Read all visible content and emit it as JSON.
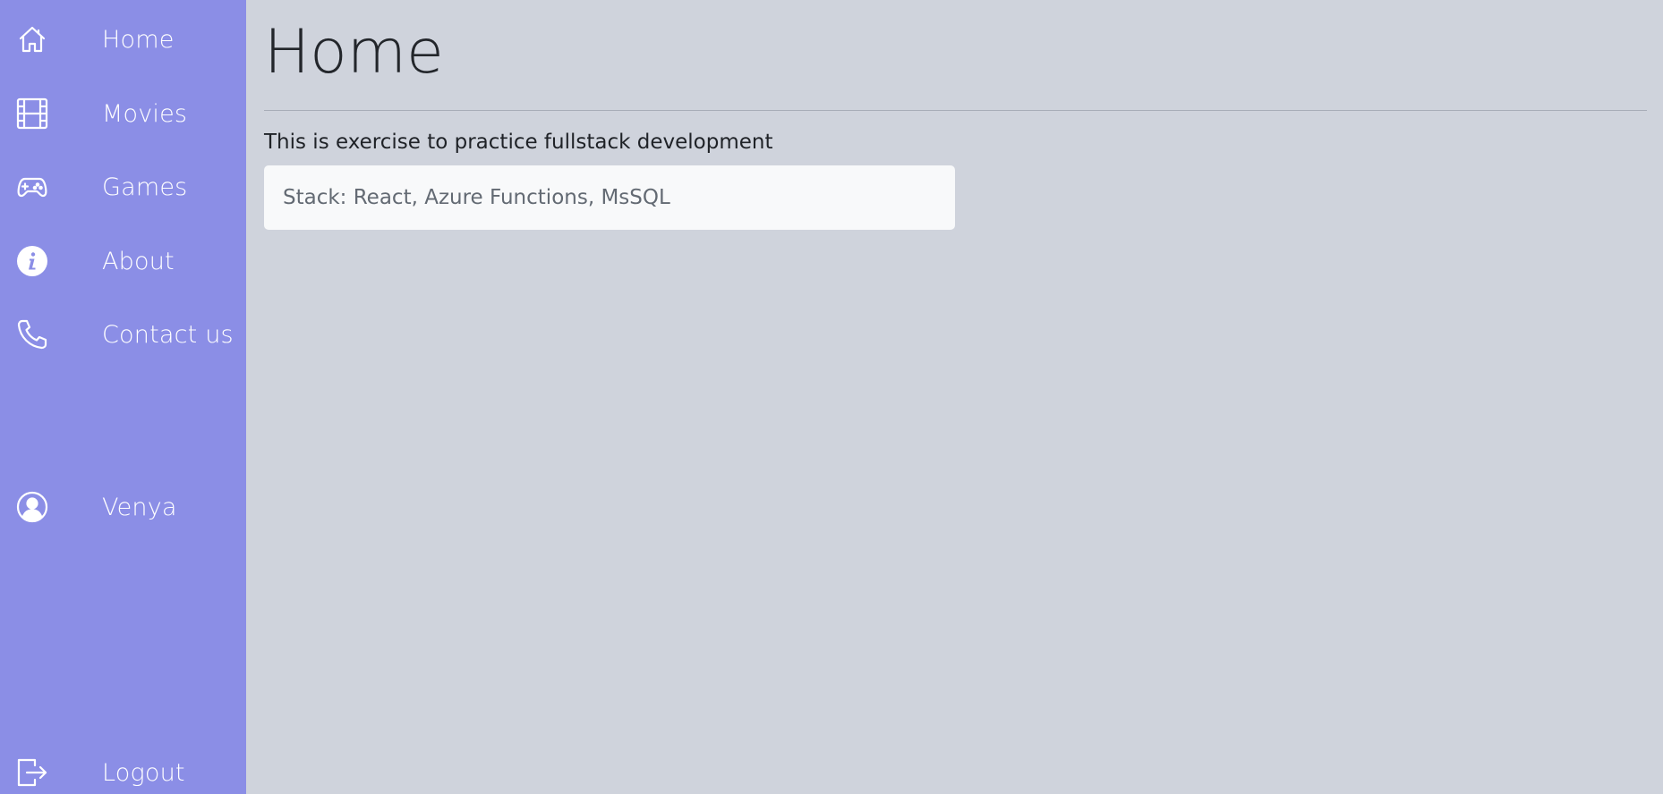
{
  "sidebar": {
    "background": "#8b8ee6",
    "items": [
      {
        "label": "Home",
        "icon": "home-icon"
      },
      {
        "label": "Movies",
        "icon": "film-icon"
      },
      {
        "label": "Games",
        "icon": "gamepad-icon"
      },
      {
        "label": "About",
        "icon": "info-icon"
      },
      {
        "label": "Contact us",
        "icon": "phone-icon"
      }
    ],
    "user": {
      "label": "Venya",
      "icon": "user-circle-icon"
    },
    "logout": {
      "label": "Logout",
      "icon": "logout-icon"
    }
  },
  "main": {
    "background": "#cfd3dc",
    "title": "Home",
    "description": "This is exercise to practice fullstack development",
    "stack_text": "Stack: React, Azure Functions, MsSQL"
  }
}
